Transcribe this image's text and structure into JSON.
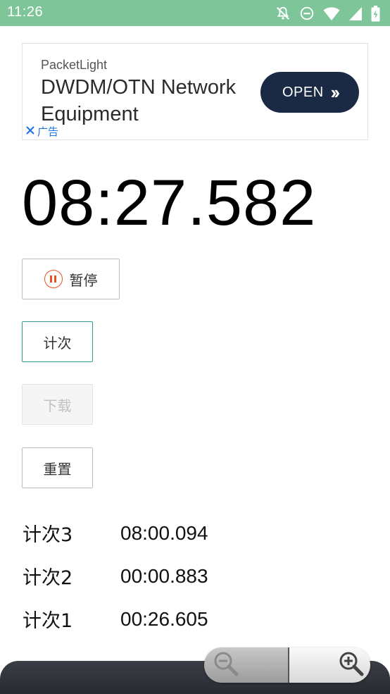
{
  "status_bar": {
    "time": "11:26",
    "icons": [
      "notifications-off-icon",
      "do-not-disturb-icon",
      "wifi-icon",
      "signal-icon",
      "battery-icon"
    ],
    "color": "#7fc59a"
  },
  "ad": {
    "brand": "PacketLight",
    "headline": "DWDM/OTN Network Equipment",
    "cta_label": "OPEN",
    "adchoice_label": "广告",
    "cta_color": "#1b2a44"
  },
  "stopwatch": {
    "display": "08:27.582"
  },
  "buttons": {
    "pause_label": "暂停",
    "lap_label": "计次",
    "download_label": "下载",
    "reset_label": "重置",
    "pause_icon_color": "#e8521e",
    "lap_border_color": "#2e9c8c"
  },
  "laps": [
    {
      "name": "计次3",
      "time": "08:00.094"
    },
    {
      "name": "计次2",
      "time": "00:00.883"
    },
    {
      "name": "计次1",
      "time": "00:26.605"
    }
  ],
  "zoom_controls": {
    "icons": [
      "zoom-out-icon",
      "zoom-in-icon"
    ]
  }
}
